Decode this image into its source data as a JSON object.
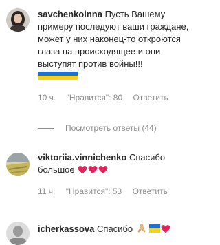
{
  "comments": [
    {
      "username": "savchenkoinna",
      "text": "Пусть Вашему примеру последуют ваши граждане, может у них наконец-то откроются глаза на происходящее и они выступят против войны!!!",
      "emoji": [
        "ukraine-flag"
      ],
      "time": "10 ч.",
      "likes": "\"Нравится\": 80",
      "reply_label": "Ответить"
    },
    {
      "username": "viktoriia.vinnichenko",
      "text": "Спасибо большое",
      "emoji": [
        "red-heart",
        "red-heart",
        "red-heart"
      ],
      "time": "11 ч.",
      "likes": "\"Нравится\": 53",
      "reply_label": "Ответить"
    },
    {
      "username": "icherkassova",
      "text": "Спасибо",
      "emoji": [
        "folded-hands",
        "ukraine-flag",
        "red-heart"
      ]
    }
  ],
  "view_replies_label": "Посмотреть ответы (44)",
  "colors": {
    "text": "#262626",
    "muted": "#8e8e8e",
    "flag_blue": "#1e73d2",
    "flag_yellow": "#f6d21a",
    "heart": "#e0245e"
  }
}
